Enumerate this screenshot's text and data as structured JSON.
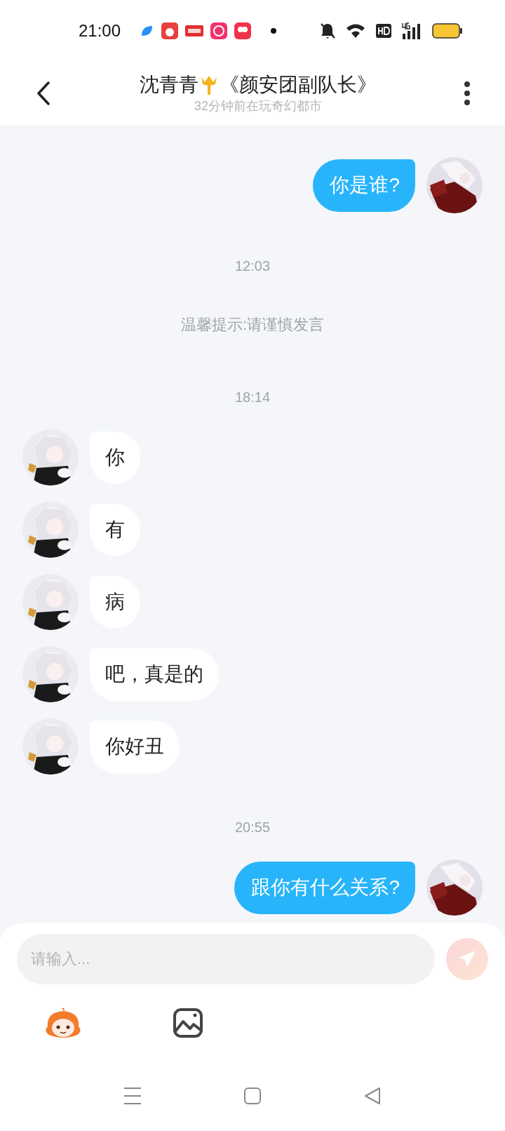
{
  "status_bar": {
    "time": "21:00"
  },
  "header": {
    "name": "沈青青",
    "title_suffix": "《颜安团副队长》",
    "subtitle": "32分钟前在玩奇幻都市"
  },
  "messages": [
    {
      "kind": "message",
      "outgoing": true,
      "text": "你是谁?"
    },
    {
      "kind": "time",
      "text": "12:03"
    },
    {
      "kind": "notice",
      "text": "温馨提示:请谨慎发言"
    },
    {
      "kind": "time",
      "text": "18:14"
    },
    {
      "kind": "message",
      "outgoing": false,
      "text": "你"
    },
    {
      "kind": "message",
      "outgoing": false,
      "text": "有"
    },
    {
      "kind": "message",
      "outgoing": false,
      "text": "病"
    },
    {
      "kind": "message",
      "outgoing": false,
      "text": "吧，真是的"
    },
    {
      "kind": "message",
      "outgoing": false,
      "text": "你好丑"
    },
    {
      "kind": "time",
      "text": "20:55"
    },
    {
      "kind": "message",
      "outgoing": true,
      "text": "跟你有什么关系?"
    }
  ],
  "composer": {
    "placeholder": "请输入..."
  }
}
